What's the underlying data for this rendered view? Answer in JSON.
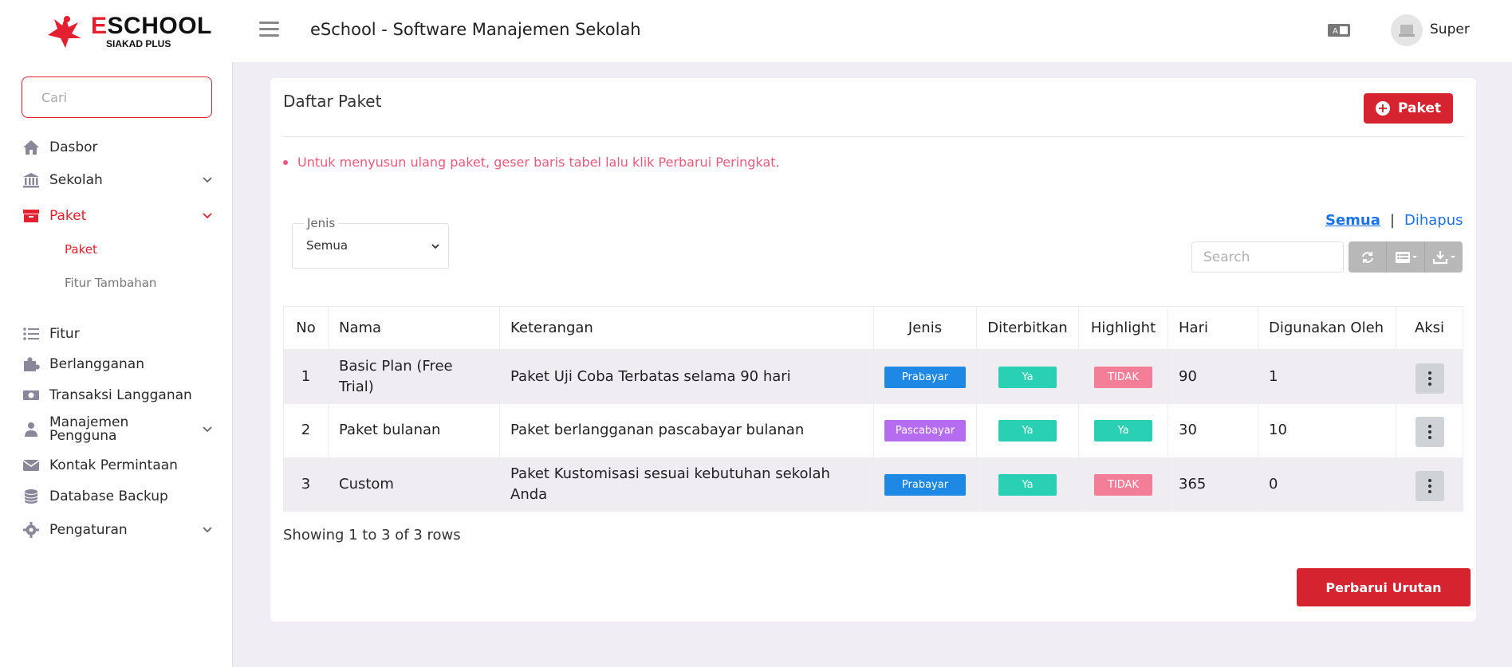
{
  "header": {
    "logo_text_prefix": "E",
    "logo_text_rest": "SCHOOL",
    "logo_sub": "SIAKAD PLUS",
    "app_title": "eSchool - Software Manajemen Sekolah",
    "user_name": "Super"
  },
  "sidebar": {
    "search_placeholder": "Cari",
    "items": [
      {
        "label": "Dasbor",
        "icon": "home-icon"
      },
      {
        "label": "Sekolah",
        "icon": "bank-icon"
      },
      {
        "label": "Paket",
        "icon": "archive-icon"
      },
      {
        "label": "Fitur",
        "icon": "list-icon"
      },
      {
        "label": "Berlangganan",
        "icon": "puzzle-icon"
      },
      {
        "label": "Transaksi Langganan",
        "icon": "money-icon"
      },
      {
        "label": "Manajemen Pengguna",
        "icon": "user-tie-icon"
      },
      {
        "label": "Kontak Permintaan",
        "icon": "envelope-icon"
      },
      {
        "label": "Database Backup",
        "icon": "database-icon"
      },
      {
        "label": "Pengaturan",
        "icon": "gear-icon"
      }
    ],
    "paket_sub": [
      "Paket",
      "Fitur Tambahan"
    ]
  },
  "main": {
    "title": "Daftar Paket",
    "add_button": "Paket",
    "notice": "Untuk menyusun ulang paket, geser baris tabel lalu klik Perbarui Peringkat.",
    "tab_all": "Semua",
    "tab_sep": "|",
    "tab_deleted": "Dihapus",
    "filter_legend": "Jenis",
    "filter_value": "Semua",
    "search_placeholder": "Search",
    "columns": [
      "No",
      "Nama",
      "Keterangan",
      "Jenis",
      "Diterbitkan",
      "Highlight",
      "Hari",
      "Digunakan Oleh",
      "Aksi"
    ],
    "rows": [
      {
        "no": "1",
        "nama": "Basic Plan (Free Trial)",
        "keterangan": "Paket Uji Coba Terbatas selama 90 hari",
        "jenis": "Prabayar",
        "diterbitkan": "Ya",
        "highlight": "TIDAK",
        "hari": "90",
        "digunakan": "1"
      },
      {
        "no": "2",
        "nama": "Paket bulanan",
        "keterangan": "Paket berlangganan pascabayar bulanan",
        "jenis": "Pascabayar",
        "diterbitkan": "Ya",
        "highlight": "Ya",
        "hari": "30",
        "digunakan": "10"
      },
      {
        "no": "3",
        "nama": "Custom",
        "keterangan": "Paket Kustomisasi sesuai kebutuhan sekolah Anda",
        "jenis": "Prabayar",
        "diterbitkan": "Ya",
        "highlight": "TIDAK",
        "hari": "365",
        "digunakan": "0"
      }
    ],
    "showing": "Showing 1 to 3 of 3 rows",
    "update_button": "Perbarui Urutan"
  },
  "colors": {
    "brand_red": "#d5232f",
    "link_blue": "#1a73e8",
    "notice_pink": "#ec5a7b",
    "prabayar": "#1e88e5",
    "pascabayar": "#b66cf0",
    "ya": "#2ad0b3",
    "tidak": "#f47e97"
  }
}
